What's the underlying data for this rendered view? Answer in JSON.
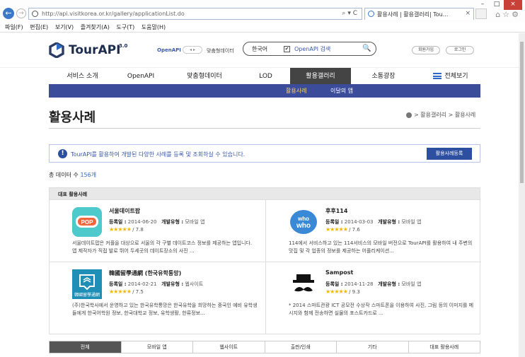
{
  "browser": {
    "url": "http://api.visitkorea.or.kr/gallery/applicationList.do",
    "address_controls": "⌕ ▾ C",
    "tab_title": "활용사례 | 활용갤러리| Tou...",
    "tab_close": "×",
    "back": "←",
    "forward": "→",
    "window": {
      "minimize": "–",
      "maximize": "□",
      "close": "×"
    },
    "toolbar_icons": "⌂☆⚙",
    "menu": [
      "파일(F)",
      "편집(E)",
      "보기(V)",
      "즐겨찾기(A)",
      "도구(T)",
      "도움말(H)"
    ]
  },
  "header": {
    "logo_text": "TourAPI",
    "logo_version": "3.0",
    "openapi_label": "OpenAPI",
    "toggle_label": "◂ ▸",
    "custom_label": "맞춤형데이터",
    "search": {
      "language": "한국어",
      "check": "✔",
      "service": "OpenAPI 검색",
      "icon": "🔍"
    },
    "signup": "회원가입",
    "login": "로그인"
  },
  "gnb": {
    "items": [
      "서비스 소개",
      "OpenAPI",
      "맞춤형데이터",
      "LOD",
      "활용갤러리",
      "소통광장"
    ],
    "all_menu": "전체보기"
  },
  "subnav": {
    "items": [
      "활용사례",
      "이달의 앱"
    ]
  },
  "page": {
    "title": "활용사례",
    "breadcrumb": "> 활용갤러리 > 활용사례",
    "info_icon": "!",
    "info_text": "TourAPI를 활용하여 개발된 다양한 사례를 등록 및 조회하실 수 있습니다.",
    "register_button": "활용사례등록",
    "total_label": "총 데이터 수",
    "total_value": "156개",
    "rep_heading": "대표 활용사례"
  },
  "cards": [
    {
      "name": "서울데이트팝",
      "reg_label": "등록일 :",
      "reg_date": "2014-06-20",
      "type_label": "개발유형 :",
      "type": "모바일 앱",
      "stars": "★★★★★",
      "score": "/ 7.8",
      "desc": "서울데이트팝은 커플을 대상으로 서울의 각 구별 데이트코스 정보를 제공하는 앱입니다. 앱 제작자가 직접 발로 뛰어 두세곳의 데이트장소의 사진 ..."
    },
    {
      "name": "후후114",
      "reg_label": "등록일 :",
      "reg_date": "2014-03-03",
      "type_label": "개발유형 :",
      "type": "모바일 앱",
      "stars": "★★★★★",
      "score": "/ 7.6",
      "desc": "114에서 서비스하고 있는 114서비스의 모바일 버전으로 TourAPI를 활용하여 내 주변의 맛집 및 각 업종의 정보를 제공하는 어플리케이션..."
    },
    {
      "name": "韓國留學通網 (한국유학통망)",
      "reg_label": "등록일 :",
      "reg_date": "2014-02-21",
      "type_label": "개발유형 :",
      "type": "웹사이트",
      "stars": "★★★★★",
      "score": "/ 7.5",
      "desc": "(주)한국학사에서 운영하고 있는 한국유학통망은 한국유학을 희망하는 중국인 예비 유학생들에게 한국어학원 정보, 한국대학교 정보, 유학생활, 한류정보..."
    },
    {
      "name": "Sampost",
      "reg_label": "등록일 :",
      "reg_date": "2014-11-28",
      "type_label": "개발유형 :",
      "type": "모바일 앱",
      "stars": "★★★★★",
      "score": "/ 9.3",
      "desc": "* 2014 스마트관광 ICT 공모전 수상작 스마트폰을 이용하여 사진, 그림 등의 이미지를 메시지와 함께 전송하면 실물의 포스트카드로 ..."
    }
  ],
  "thumb_labels": {
    "pop": "POP",
    "whowho_top": "who",
    "whowho_bottom": "who",
    "study": "韓國留學通網"
  },
  "filter_tabs": [
    "전체",
    "모바일 앱",
    "웹사이트",
    "출판/인쇄",
    "기타",
    "대표 활용사례"
  ]
}
